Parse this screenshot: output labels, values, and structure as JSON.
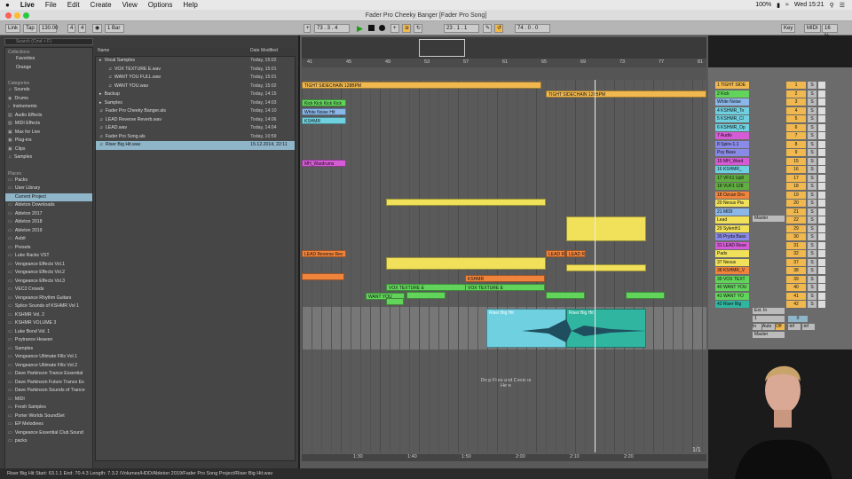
{
  "menubar": {
    "apple": "",
    "app": "Live",
    "items": [
      "File",
      "Edit",
      "Create",
      "View",
      "Options",
      "Help"
    ],
    "clock": "Wed 15:21",
    "battery": "100%"
  },
  "window": {
    "title": "Fader Pro Cheeky Banger  [Fader Pro Song]"
  },
  "transport": {
    "link": "Link",
    "tempo": "130.00",
    "sig_num": "4",
    "sig_den": "4",
    "quant": "1 Bar",
    "position": "73 . 3 . 4",
    "loop_start": "23 . 1 . 1",
    "loop_len": "74 . 0 . 0",
    "key": "Key",
    "midi": "MIDI",
    "cpu": "16 %"
  },
  "browser": {
    "search_placeholder": "Search (Cmd + F)",
    "collections_label": "Collections",
    "collections": [
      "Favorites",
      "Orange"
    ],
    "categories_label": "Categories",
    "categories": [
      "Sounds",
      "Drums",
      "Instruments",
      "Audio Effects",
      "MIDI Effects",
      "Max for Live",
      "Plug-ins",
      "Clips",
      "Samples"
    ],
    "places_label": "Places",
    "places": [
      "Packs",
      "User Library",
      "Current Project",
      "Ableton Downloads",
      "Ableton 2017",
      "Ableton 2018",
      "Ableton 2019",
      "Aubit",
      "Presets",
      "Luke Racks VST",
      "Vengeance Effects Vol.1",
      "Vengeance Effects Vol.2",
      "Vengeance Effects Vol.3",
      "VEC2 Crowds",
      "Vengeance Rhythm Guitars",
      "Splice Sounds of KSHMR Vol 1",
      "KSHMR Vol. 2",
      "KSHMR VOLUME 3",
      "Luke Bond Vol. 1",
      "Psytrance Heaven",
      "Samples",
      "Vengeance Ultimate Fills Vol.1",
      "Vengeance Ultimate Fills Vol.2",
      "Dave Parkinson Trance Essential",
      "Dave Parkinson Future Trance Es",
      "Dave Parkinson Sounds of Trance",
      "MIDI",
      "Fresh Samples",
      "Porter Worlds SoundSet",
      "EP Melodiees",
      "Vengeance Essential Club Sound",
      "packs"
    ],
    "col_name": "Name",
    "col_date": "Date Modified",
    "files": [
      {
        "name": "Vocal Samples",
        "date": "Today, 15:02",
        "indent": 0
      },
      {
        "name": "VOX TEXTURE E.wav",
        "date": "Today, 15:01",
        "indent": 1
      },
      {
        "name": "WANT YOU FULL.wav",
        "date": "Today, 15:01",
        "indent": 1
      },
      {
        "name": "WANT YOU.wav",
        "date": "Today, 15:02",
        "indent": 1
      },
      {
        "name": "Backup",
        "date": "Today, 14:15",
        "indent": 0
      },
      {
        "name": "Samples",
        "date": "Today, 14:03",
        "indent": 0
      },
      {
        "name": "Fader Pro Cheeky Banger.als",
        "date": "Today, 14:10",
        "indent": 0
      },
      {
        "name": "LEAD Reverse Reverb.wav",
        "date": "Today, 14:06",
        "indent": 0
      },
      {
        "name": "LEAD.wav",
        "date": "Today, 14:04",
        "indent": 0
      },
      {
        "name": "Fader Pro Song.als",
        "date": "Today, 10:59",
        "indent": 0
      },
      {
        "name": "Riser Big Hit.wav",
        "date": "15.12.2014, 22:11",
        "indent": 0
      }
    ]
  },
  "ruler": {
    "bars": [
      "41",
      "45",
      "49",
      "53",
      "57",
      "61",
      "65",
      "69",
      "73",
      "77",
      "81"
    ],
    "times": [
      "1:30",
      "1:40",
      "1:50",
      "2:00",
      "2:10",
      "2:20"
    ]
  },
  "arrangement": {
    "drop_hint": "Drop Files and Devices Here",
    "zoom": "1/1",
    "clips": [
      {
        "label": "TIGHT SIDECHAIN 128BPM",
        "color": "#f0b84f"
      },
      {
        "label": "TIGHT SIDECHAIN 128BPM",
        "color": "#f0b84f"
      },
      {
        "label": "Kick Kick Kick Kick",
        "color": "#62d45b"
      },
      {
        "label": "White Noise Hit",
        "color": "#8ab6e8"
      },
      {
        "label": "KSHMR",
        "color": "#6fd0e0"
      },
      {
        "label": "MH_Wardrums",
        "color": "#d65bd6"
      },
      {
        "label": "LEAD Reverse Rev",
        "color": "#f0843c"
      },
      {
        "label": "LEAD Re",
        "color": "#f0843c"
      },
      {
        "label": "LEAD Re",
        "color": "#f0843c"
      },
      {
        "label": "KSHMR",
        "color": "#f0843c"
      },
      {
        "label": "VOX TEXTURE E",
        "color": "#62d45b"
      },
      {
        "label": "VOX TEXTURE E",
        "color": "#62d45b"
      },
      {
        "label": "WANT YOU",
        "color": "#62d45b"
      },
      {
        "label": "Riser Big Hit",
        "color": "#6fd0e0"
      },
      {
        "label": "Riser Big Hit",
        "color": "#2fb5a0"
      }
    ]
  },
  "tracks": [
    {
      "name": "1 TIGHT SIDE",
      "num": "1",
      "color": "#f0b84f"
    },
    {
      "name": "2 Kick",
      "num": "2",
      "color": "#62d45b"
    },
    {
      "name": "White Noise",
      "num": "3",
      "color": "#8ab6e8"
    },
    {
      "name": "4 KSHMR_To",
      "num": "4",
      "color": "#6fd0e0"
    },
    {
      "name": "5 KSHMR_Cl",
      "num": "5",
      "color": "#6fd0e0"
    },
    {
      "name": "6 KSHMR_Op",
      "num": "6",
      "color": "#6fd0e0"
    },
    {
      "name": "7 Audio",
      "num": "7",
      "color": "#d65bd6"
    },
    {
      "name": "8 Spire-1.1",
      "num": "8",
      "color": "#8a8ae8"
    },
    {
      "name": "Psy Bass",
      "num": "9",
      "color": "#8a8ae8"
    },
    {
      "name": "15 MH_Ward",
      "num": "15",
      "color": "#d65bd6"
    },
    {
      "name": "16 KSHMR_",
      "num": "16",
      "color": "#6fd0e0"
    },
    {
      "name": "17 VFX1 Up8",
      "num": "17",
      "color": "#5fae3f"
    },
    {
      "name": "18 VUF1 128",
      "num": "18",
      "color": "#5fae3f"
    },
    {
      "name": "18 Ozcan Dro",
      "num": "19",
      "color": "#f0843c"
    },
    {
      "name": "20 Nexus Pia",
      "num": "20",
      "color": "#f0e05a"
    },
    {
      "name": "21 MIDI",
      "num": "21",
      "color": "#8ab6e8"
    },
    {
      "name": "Lead",
      "num": "22",
      "color": "#f0e05a"
    },
    {
      "name": "29 Sylenth1",
      "num": "29",
      "color": "#f0e05a"
    },
    {
      "name": "30 Pryda Bass",
      "num": "30",
      "color": "#8a8ae8"
    },
    {
      "name": "31 LEAD Reve",
      "num": "31",
      "color": "#d65bd6"
    },
    {
      "name": "Pads",
      "num": "32",
      "color": "#f0e05a"
    },
    {
      "name": "37 Nexus",
      "num": "37",
      "color": "#f0e05a"
    },
    {
      "name": "38 KSHMR_V",
      "num": "38",
      "color": "#f0843c"
    },
    {
      "name": "39 VOX TEXT",
      "num": "39",
      "color": "#62d45b"
    },
    {
      "name": "40 WANT YOU",
      "num": "40",
      "color": "#62d45b"
    },
    {
      "name": "41 WANT YO",
      "num": "41",
      "color": "#62d45b"
    },
    {
      "name": "42 Riser Big",
      "num": "42",
      "color": "#2fb5a0"
    }
  ],
  "io": {
    "master": "Master",
    "ext_in": "Ext. In",
    "ch": "1",
    "in": "In",
    "auto": "Auto",
    "off": "Off",
    "inf": "-inf",
    "vol": "0"
  },
  "status": "Riser Big Hit  Start: 63.1.1  End: 70.4.3  Length: 7.3.2  /Volumes/HDD/Ableton 2019/Fader Pro Song Project/Riser Big Hit.wav"
}
